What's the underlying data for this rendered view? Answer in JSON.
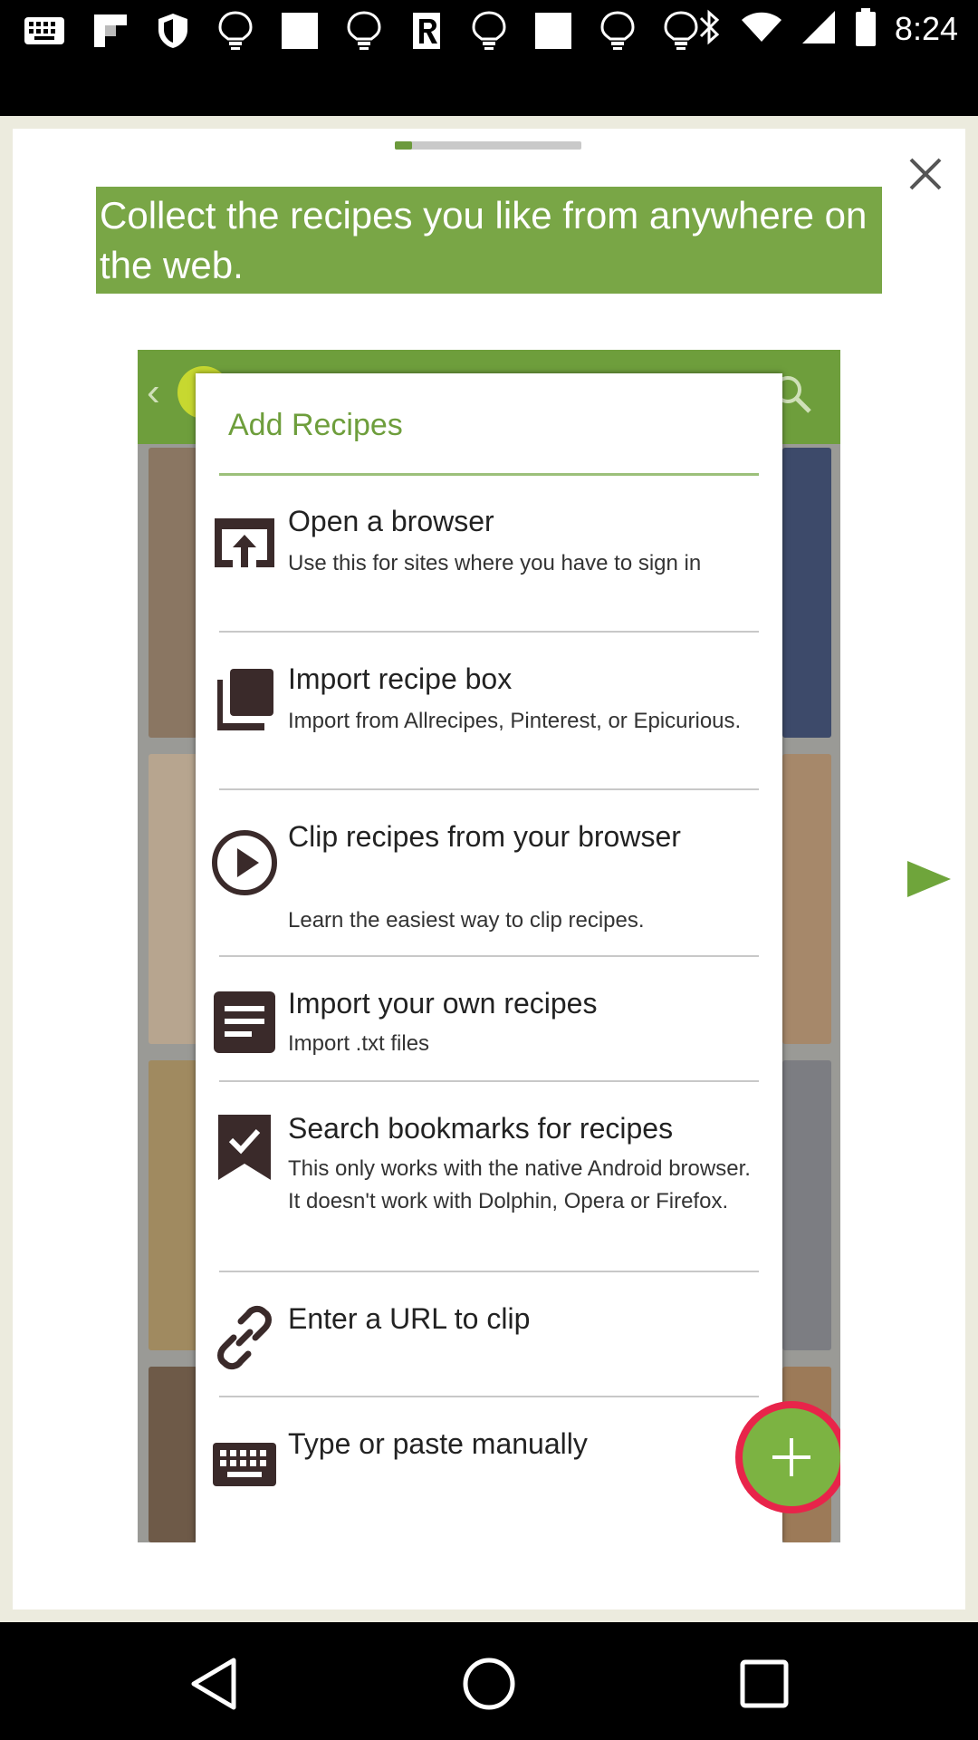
{
  "status_bar": {
    "time": "8:24",
    "icons": [
      "keyboard-icon",
      "flipboard-icon",
      "shield-icon",
      "lightbulb-icon",
      "square-icon",
      "lightbulb-icon",
      "r-app-icon",
      "lightbulb-icon",
      "square-icon",
      "lightbulb-icon",
      "lightbulb-icon",
      "bluetooth-icon",
      "wifi-icon",
      "signal-icon",
      "battery-icon"
    ]
  },
  "tutorial": {
    "progress_fraction": 0.09,
    "headline": "Collect the recipes you like from anywhere on the web.",
    "close_icon": "close-icon",
    "next_icon": "play-next-icon"
  },
  "dialog": {
    "title": "Add Recipes",
    "items": [
      {
        "title": "Open a browser",
        "desc": "Use this for sites where you have to sign in",
        "icon": "open-in-browser-icon"
      },
      {
        "title": "Import recipe box",
        "desc": "Import from Allrecipes, Pinterest, or Epicurious.",
        "icon": "library-icon"
      },
      {
        "title": "Clip recipes from your browser",
        "desc": "Learn the easiest way to clip recipes.",
        "icon": "play-circle-icon"
      },
      {
        "title": "Import your own recipes",
        "desc": "Import .txt files",
        "icon": "document-icon"
      },
      {
        "title": "Search bookmarks for recipes",
        "desc": "This only works with the native Android browser. It doesn't work with Dolphin, Opera or Firefox.",
        "icon": "bookmark-check-icon"
      },
      {
        "title": "Enter a URL to clip",
        "desc": "",
        "icon": "link-icon"
      },
      {
        "title": "Type or paste manually",
        "desc": "",
        "icon": "keyboard-icon"
      }
    ],
    "fab_icon": "plus-icon"
  },
  "colors": {
    "accent_green": "#79a646",
    "fab_ring": "#e8244a"
  },
  "nav_bar": {
    "icons": [
      "back-icon",
      "home-icon",
      "recents-icon"
    ]
  }
}
